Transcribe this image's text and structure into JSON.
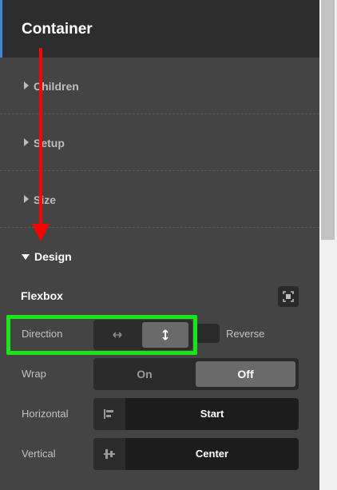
{
  "header": {
    "title": "Container"
  },
  "sections": [
    {
      "label": "Children"
    },
    {
      "label": "Setup"
    },
    {
      "label": "Size"
    }
  ],
  "design": {
    "label": "Design",
    "flexbox": {
      "label": "Flexbox",
      "expand_icon": "expand-icon"
    },
    "direction": {
      "label": "Direction",
      "options": [
        "horizontal-arrow-icon",
        "vertical-arrow-icon"
      ],
      "selected": "vertical",
      "reverse_label": "Reverse"
    },
    "wrap": {
      "label": "Wrap",
      "on": "On",
      "off": "Off",
      "selected": "Off"
    },
    "horizontal": {
      "label": "Horizontal",
      "value": "Start",
      "icon": "align-start-icon"
    },
    "vertical": {
      "label": "Vertical",
      "value": "Center",
      "icon": "align-center-icon"
    }
  },
  "annotations": {
    "arrow_color": "#ff0000",
    "highlight_color": "#19e619"
  },
  "colors": {
    "accent": "#3b8ad8",
    "panel": "#444444",
    "header": "#2d2d2d"
  }
}
